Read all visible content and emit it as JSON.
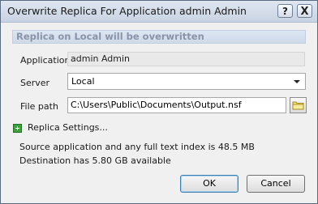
{
  "window": {
    "title": "Overwrite Replica For Application admin Admin",
    "help_label": "?",
    "close_label": "X"
  },
  "banner": {
    "text": "Replica on Local will be overwritten"
  },
  "form": {
    "application_label": "Application",
    "application_value": "admin Admin",
    "server_label": "Server",
    "server_value": "Local",
    "filepath_label": "File path",
    "filepath_value": "C:\\Users\\Public\\Documents\\Output.nsf"
  },
  "replica_settings": {
    "label": "Replica Settings..."
  },
  "info": {
    "source_size": "Source application and any full text index is 48.5 MB",
    "destination": "Destination has 5.80 GB available"
  },
  "buttons": {
    "ok": "OK",
    "cancel": "Cancel"
  },
  "icons": {
    "folder": "folder-icon",
    "expand": "plus-icon"
  }
}
